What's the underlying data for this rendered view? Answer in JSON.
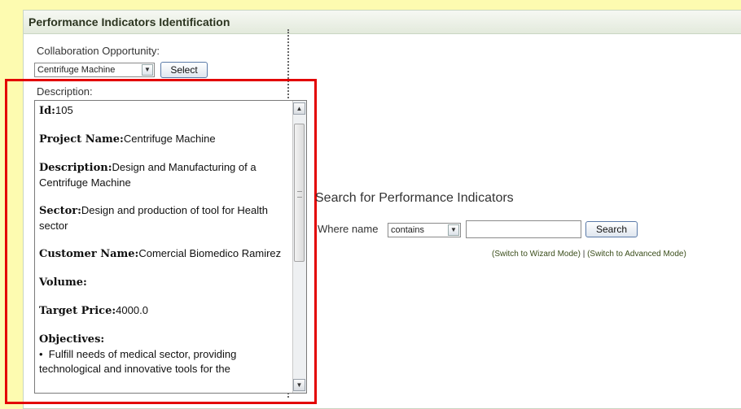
{
  "panel": {
    "title": "Performance Indicators Identification"
  },
  "collaboration": {
    "label": "Collaboration Opportunity:",
    "selected": "Centrifuge Machine",
    "select_button": "Select"
  },
  "description": {
    "label": "Description:",
    "id_label": "Id:",
    "id_value": "105",
    "project_label": "Project Name:",
    "project_value": "Centrifuge Machine",
    "desc_label": "Description:",
    "desc_value": "Design and Manufacturing of a Centrifuge Machine",
    "sector_label": "Sector:",
    "sector_value": "Design and production of tool for Health sector",
    "customer_label": "Customer Name:",
    "customer_value": "Comercial Biomedico Ramirez",
    "volume_label": "Volume:",
    "price_label": "Target Price:",
    "price_value": "4000.0",
    "objectives_label": "Objectives:",
    "objective_1": "Fulfill needs of medical sector, providing technological and innovative tools for the"
  },
  "search": {
    "title": "Search for Performance Indicators",
    "where_label": "Where name",
    "operator": "contains",
    "query": "",
    "button": "Search",
    "wizard_link": "(Switch to Wizard Mode)",
    "separator": "|",
    "advanced_link": "(Switch to Advanced Mode)"
  },
  "colors": {
    "highlight": "#e30000",
    "background": "#fdfbb0"
  }
}
